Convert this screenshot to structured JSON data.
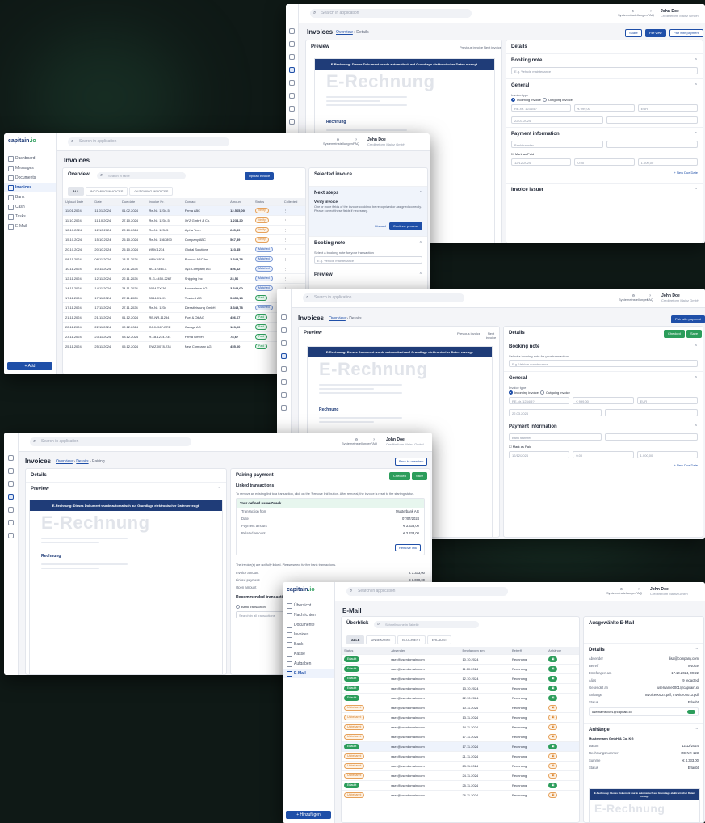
{
  "app": {
    "brand_a": "capitain",
    "brand_b": ".io"
  },
  "search": {
    "placeholder": "Search in application"
  },
  "toolbar": {
    "systemsettings": "Systemeinstellungen",
    "help": "FAQ"
  },
  "user": {
    "name": "John Doe",
    "company": "Creditreform Mainz GmbH"
  },
  "nav": {
    "items": [
      "Dashboard",
      "Messages",
      "Documents",
      "Invoices",
      "Bank",
      "Cash",
      "Tasks",
      "E-Mail"
    ],
    "add_label": "Add"
  },
  "nav_de": {
    "items": [
      "Übersicht",
      "Nachrichten",
      "Dokumente",
      "Invoices",
      "Bank",
      "Kasse",
      "Aufgaben",
      "E-Mail"
    ],
    "add_label": "Hinzufügen"
  },
  "invoices": {
    "title": "Invoices",
    "overview": "Overview",
    "search_placeholder": "Search in table",
    "upload_label": "Upload invoice",
    "tabs": [
      "ALL",
      "INCOMING INVOICES",
      "OUTGOING INVOICES"
    ],
    "columns": [
      "Upload Date",
      "Date",
      "Due date",
      "Invoice Nr.",
      "Contact",
      "Amount",
      "Status",
      "Collected"
    ],
    "rows": [
      [
        "11.01.2024",
        "11.01.2024",
        "01.02.2024",
        "Re-Nr. 1234-5",
        "Firma ABC",
        "12.565,00",
        "o",
        "Verify"
      ],
      [
        "11.10.2024",
        "11.10.2024",
        "27.10.2024",
        "Re-Nr. 1234-5",
        "XYZ GmbH & Co.",
        "1.234,20",
        "o",
        "Verify"
      ],
      [
        "12.10.2024",
        "12.10.2024",
        "22.10.2024",
        "Re-Nr. 12345",
        "Alpha Tech",
        "245,39",
        "o",
        "Verify"
      ],
      [
        "15.10.2024",
        "15.10.2024",
        "25.10.2024",
        "Re-Nr. 1567890",
        "Company ABC",
        "567,89",
        "o",
        "Verify"
      ],
      [
        "20.10.2024",
        "20.10.2024",
        "25.10.2024",
        "#INV-1234",
        "Global Solutions",
        "123,45",
        "b",
        "Matched"
      ],
      [
        "08.11.2024",
        "08.11.2024",
        "18.11.2024",
        "#INV-4578",
        "Product ABC Inc",
        "2.345,78",
        "b",
        "Matched"
      ],
      [
        "10.11.2024",
        "10.11.2024",
        "20.11.2024",
        "AC-12345-X",
        "XyZ Company AG",
        "456,12",
        "b",
        "Matched"
      ],
      [
        "12.11.2024",
        "12.11.2024",
        "22.11.2024",
        "R-G-4450-2267",
        "Shipping Inc",
        "23,56",
        "b",
        "Matched"
      ],
      [
        "14.11.2024",
        "14.11.2024",
        "24.11.2024",
        "5024-TX-36",
        "Musterfirma AG",
        "3.345,00",
        "b",
        "Matched"
      ],
      [
        "17.11.2024",
        "17.11.2024",
        "27.11.2024",
        "3334-01-XX",
        "Tracked AG",
        "5.456,18",
        "g",
        "Paid"
      ],
      [
        "17.11.2024",
        "17.11.2024",
        "27.11.2024",
        "Re-Nr. 1234",
        "Dienstleistung GmbH",
        "3.345,78",
        "b",
        "Matched"
      ],
      [
        "21.11.2024",
        "21.11.2024",
        "01.12.2024",
        "RE-NR-11234",
        "Fuel & Oil AG",
        "456,67",
        "g",
        "Paid"
      ],
      [
        "22.11.2024",
        "22.11.2024",
        "02.12.2024",
        "CJ-04567-BRE",
        "Garage AG",
        "123,00",
        "g",
        "Paid"
      ],
      [
        "23.11.2024",
        "23.11.2024",
        "03.12.2024",
        "R-18-1234-234",
        "Firma GmbH",
        "78,67",
        "g",
        "Paid"
      ],
      [
        "25.11.2024",
        "25.11.2024",
        "05.12.2024",
        "EWZ-0078-234",
        "New Company AG",
        "455,00",
        "g",
        "Paid"
      ]
    ],
    "selected": "Selected invoice",
    "next_steps": "Next steps",
    "verify_title": "Verify invoice",
    "verify_text": "One or more fields of the invoice could not be recognized or assigned correctly. Please correct these fields if necessary.",
    "discard": "Discard",
    "continue": "Continue process",
    "booking_note": "Booking note",
    "booking_hint": "Select a booking note for your transaction",
    "booking_placeholder": "E.g. Vehicle maintenance",
    "preview": "Preview"
  },
  "details": {
    "title": "Invoices",
    "crumb_overview": "Overview",
    "crumb_details": "Details",
    "crumb_pairing": "Pairing",
    "preview": "Preview",
    "details": "Details",
    "prev": "Previous invoice",
    "next": "Next invoice",
    "banner": "E-Rechnung: Dieses Dokument wurde automatisch auf Grundlage elektronischer Daten erzeugt.",
    "doc_title": "E-Rechnung",
    "rechnung": "Rechnung",
    "booking_note": "Booking note",
    "general": "General",
    "invoice_type": "Invoice type",
    "incoming": "Incoming invoice",
    "outgoing": "Outgoing invoice",
    "invoice_nr_label": "Invoice Nr.*",
    "invoice_nr": "RE-Nr. 1234/5?",
    "total_label": "Total amount*",
    "total": "€ 999,00",
    "currency_label": "Currency*",
    "currency": "EUR",
    "invoice_date_label": "Invoice date*",
    "invoice_date": "22.03.2024",
    "due_label": "Due Date",
    "payment_info": "Payment information",
    "payment_method_label": "Payment method",
    "payment_method": "Bank transfer",
    "date_label": "Date",
    "mark_paid": "Mark as Paid",
    "due_date_value": "12/12/2024",
    "discount_label": "Discount",
    "discount": "0.00",
    "amount_due_label": "Amount Due",
    "amount_due": "1.000,00",
    "new_due_date": "+ New Due Date",
    "invoice_issuer": "Invoice issuer",
    "share": "Share",
    "file_view": "File view",
    "pair_payment": "Pair with payment",
    "checked": "Checked",
    "save": "Save"
  },
  "pairing": {
    "title": "Pairing payment",
    "linked": "Linked transactions",
    "linked_text": "To remove an existing link to a transaction, click on the 'Remove link' button. After removal, the invoice is reset to the starting status.",
    "txn_title": "Your defined name/Zweck",
    "txn_rows": [
      [
        "Transaction from",
        "Musterbank AG"
      ],
      [
        "Date",
        "07/07/2024"
      ],
      [
        "Payment amount",
        "€ 3.333,00"
      ],
      [
        "Related amount",
        "€ 3.333,00"
      ]
    ],
    "remove": "Remove link",
    "not_fully": "The invoice(s) are not fully linked. Please select further bank transactions.",
    "invoice_amount": "Invoice amount",
    "linked_payment": "Linked payment",
    "open_amount": "Open amount",
    "ia": "€ 3.333,00",
    "lp": "€ 1.000,00",
    "oa": "€ 2.333,00",
    "recommended": "Recommended transactions",
    "back": "Back to overview",
    "bank_txn": "Bank transaction",
    "search": "Search in all transactions"
  },
  "email": {
    "title": "E-Mail",
    "overview": "Überblick",
    "search_placeholder": "Schnellsuche in Tabelle",
    "tabs": [
      "ALLE",
      "UNBEKANNT",
      "BLOCKIERT",
      "ERLAUBT"
    ],
    "columns": [
      "Status",
      "Absender",
      "Empfangen am",
      "Betreff",
      "Anhänge"
    ],
    "rows": [
      [
        "g",
        "Erlaubt",
        "user@userdomain.com",
        "10.10.2024",
        "Rechnung"
      ],
      [
        "g",
        "Erlaubt",
        "user@userdomain.com",
        "11.10.2024",
        "Rechnung"
      ],
      [
        "g",
        "Erlaubt",
        "user@userdomain.com",
        "12.10.2024",
        "Rechnung"
      ],
      [
        "g",
        "Erlaubt",
        "user@userdomain.com",
        "13.10.2024",
        "Rechnung"
      ],
      [
        "g",
        "Erlaubt",
        "user@userdomain.com",
        "22.10.2024",
        "Rechnung"
      ],
      [
        "o",
        "Unbekannt",
        "user@userdomain.com",
        "10.11.2024",
        "Rechnung"
      ],
      [
        "o",
        "Unbekannt",
        "user@userdomain.com",
        "13.11.2024",
        "Rechnung"
      ],
      [
        "o",
        "Unbekannt",
        "user@userdomain.com",
        "14.11.2024",
        "Rechnung"
      ],
      [
        "o",
        "Unbekannt",
        "user@userdomain.com",
        "17.11.2024",
        "Rechnung"
      ],
      [
        "g",
        "Erlaubt",
        "user@userdomain.com",
        "17.11.2024",
        "Rechnung"
      ],
      [
        "o",
        "Unbekannt",
        "user@userdomain.com",
        "21.11.2024",
        "Rechnung"
      ],
      [
        "o",
        "Unbekannt",
        "user@userdomain.com",
        "23.11.2024",
        "Rechnung"
      ],
      [
        "o",
        "Unbekannt",
        "user@userdomain.com",
        "24.11.2024",
        "Rechnung"
      ],
      [
        "g",
        "Erlaubt",
        "user@userdomain.com",
        "25.11.2024",
        "Rechnung"
      ],
      [
        "o",
        "Unbekannt",
        "user@userdomain.com",
        "26.11.2024",
        "Rechnung"
      ]
    ],
    "selected": "Ausgewählte E-Mail",
    "details": "Details",
    "kv": [
      [
        "Absender",
        "lisa@company.com"
      ],
      [
        "Betreff",
        "Invoice"
      ],
      [
        "Empfangen am",
        "17.10.2024, 09:22"
      ],
      [
        "Alias",
        "9 redacted"
      ],
      [
        "Gesendet an",
        "username0001@capitain.io"
      ],
      [
        "Anhänge",
        "Invoice00024.pdf, Invoice00013.pdf"
      ],
      [
        "Status",
        "Erlaubt"
      ]
    ],
    "attachments": "Anhänge",
    "att_company": "Mustermann GmbH & Co. KG",
    "att_kv": [
      [
        "Datum",
        "12/12/2024"
      ],
      [
        "Rechnungsnummer",
        "RE-NR-123"
      ],
      [
        "Summe",
        "€ 4.333,00"
      ],
      [
        "Status",
        "Erlaubt"
      ]
    ],
    "alias": "username0001@capitain.io"
  },
  "colors": {
    "primary": "#1f4fa8",
    "green": "#2c9d5b",
    "orange": "#d9822b",
    "navy": "#1f3c78"
  }
}
